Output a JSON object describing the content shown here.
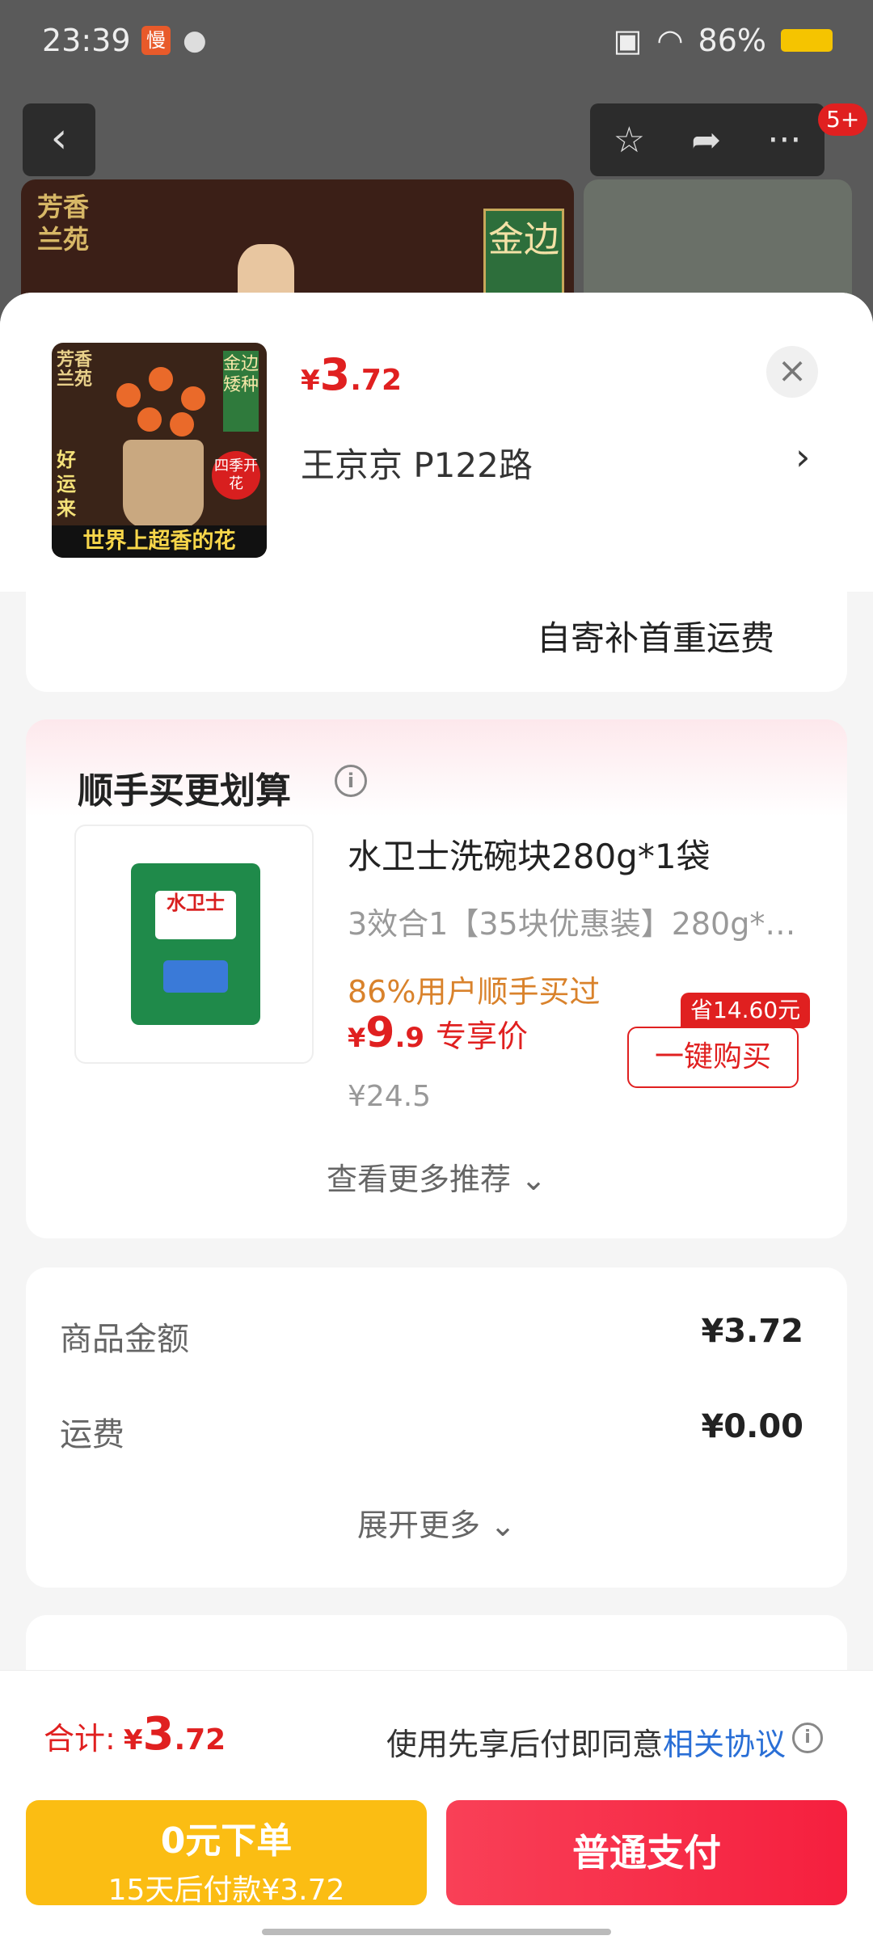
{
  "status_bar": {
    "time": "23:39",
    "app_icon_text": "慢",
    "battery": "86%"
  },
  "nav": {
    "back": "‹",
    "badge": "5+"
  },
  "background": {
    "store_text": "芳香兰苑",
    "tag_text": "金边"
  },
  "product": {
    "price_currency": "¥",
    "price_int": "3",
    "price_dec": ".72",
    "address": "王京京  P122路",
    "thumb_brand": "芳香兰苑",
    "thumb_tag": "金边矮种",
    "thumb_badge": "四季开花",
    "thumb_side": "好运来",
    "thumb_banner": "世界上超香的花"
  },
  "shipping": {
    "note": "自寄补首重运费"
  },
  "recommend": {
    "title": "顺手买更划算",
    "item_name": "水卫士洗碗块280g*1袋",
    "item_desc": "3效合1【35块优惠装】280g*…",
    "pack_label": "水卫士",
    "buyers": "86%用户顺手买过",
    "price_currency": "¥",
    "price_int": "9",
    "price_dec": ".9",
    "price_label": "专享价",
    "original_price": "¥24.5",
    "save_badge": "省14.60元",
    "buy_button": "一键购买",
    "more": "查看更多推荐"
  },
  "summary": {
    "rows": [
      {
        "label": "商品金额",
        "value": "¥3.72"
      },
      {
        "label": "运费",
        "value": "¥0.00"
      }
    ],
    "expand": "展开更多"
  },
  "bottom_bar": {
    "total_label": "合计:",
    "total_currency": "¥",
    "total_int": "3",
    "total_dec": ".72",
    "agree_text": "使用先享后付即同意",
    "agree_link": "相关协议",
    "credit_line1": "0元下单",
    "credit_line2": "15天后付款¥3.72",
    "pay_button": "普通支付"
  },
  "colors": {
    "accent": "#e02020",
    "credit_button": "#fbbd13",
    "pay_button": "#f51f3e",
    "link": "#2a6fd6"
  },
  "icons": {
    "close": "close-icon",
    "star": "star-icon",
    "share": "share-icon",
    "more": "more-icon",
    "info": "info-icon",
    "chevron": "chevron-right-icon"
  }
}
